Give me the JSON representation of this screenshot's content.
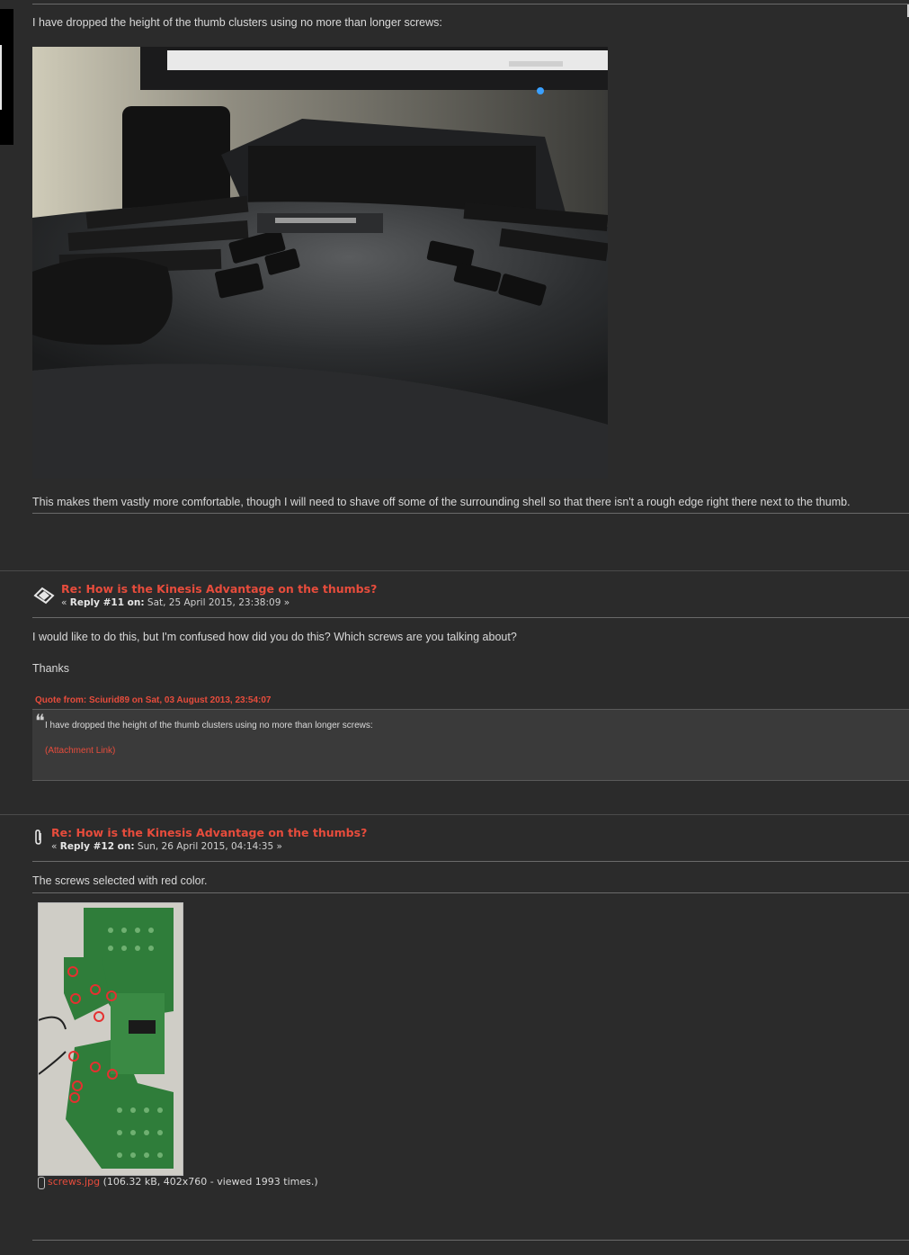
{
  "post_top": {
    "text_intro": "I have dropped the height of the thumb clusters using no more than longer screws:",
    "image_alt": "keyboard-photo",
    "text_after": "This makes them vastly more comfortable, though I will need to shave off some of the surrounding shell so that there isn't a rough edge right there next to the thumb."
  },
  "reply11": {
    "subject": "Re: How is the Kinesis Advantage on the thumbs?",
    "meta_prefix": "«",
    "meta_reply": "Reply #11 on:",
    "meta_date": "Sat, 25 April 2015, 23:38:09",
    "meta_suffix": "»",
    "body_line1": "I would like to do this, but I'm confused how did you do this? Which screws are you talking about?",
    "body_line2": "Thanks",
    "quote_header": "Quote from: Sciurid89 on Sat, 03 August 2013, 23:54:07",
    "quote_text": "I have dropped the height of the thumb clusters using no more than longer screws:",
    "quote_link": "(Attachment Link)"
  },
  "reply12": {
    "subject": "Re: How is the Kinesis Advantage on the thumbs?",
    "meta_prefix": "«",
    "meta_reply": "Reply #12 on:",
    "meta_date": "Sun, 26 April 2015, 04:14:35",
    "meta_suffix": "»",
    "body": "The screws selected with red color.",
    "attachment_name": "screws.jpg",
    "attachment_info": "(106.32 kB, 402x760 - viewed 1993 times.)"
  },
  "colors": {
    "background": "#2b2b2b",
    "link": "#e74c3c",
    "text": "#d9d9d9"
  }
}
